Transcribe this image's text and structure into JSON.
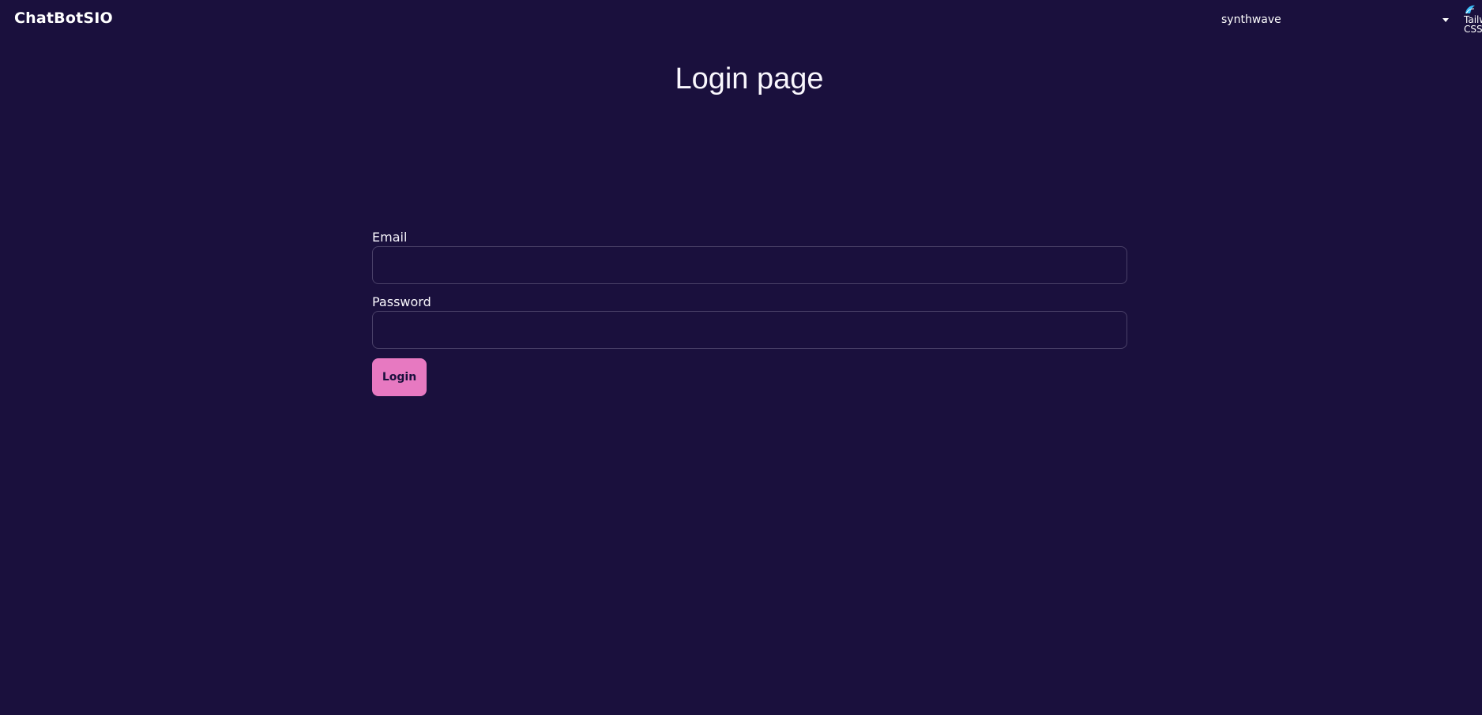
{
  "navbar": {
    "brand": "ChatBotSIO",
    "theme_select": {
      "value": "synthwave",
      "icon": "chevron-down-icon"
    },
    "logo": {
      "alt_text": "Tailwind CSS",
      "icon": "tailwind-logo-icon"
    }
  },
  "main": {
    "title": "Login page",
    "form": {
      "email_label": "Email",
      "email_value": "",
      "password_label": "Password",
      "password_value": "",
      "login_button": "Login"
    }
  },
  "colors": {
    "background": "#1a103d",
    "accent": "#e779c1",
    "text": "#f9f7fd",
    "input_border": "#4a4168"
  }
}
